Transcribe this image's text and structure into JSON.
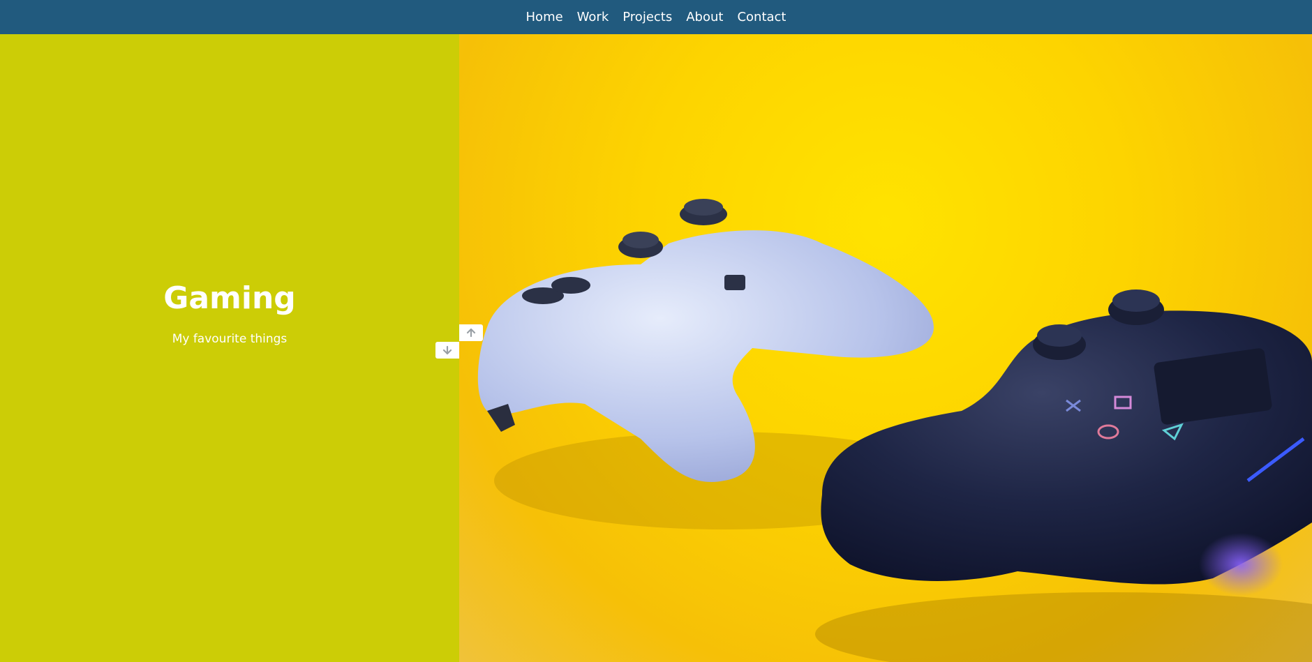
{
  "nav": {
    "items": [
      {
        "label": "Home"
      },
      {
        "label": "Work"
      },
      {
        "label": "Projects"
      },
      {
        "label": "About"
      },
      {
        "label": "Contact"
      }
    ]
  },
  "hero": {
    "title": "Gaming",
    "subtitle": "My favourite things"
  },
  "photo": {
    "subject": "two game controllers on yellow background"
  },
  "controls": {
    "up_icon": "arrow-up-icon",
    "down_icon": "arrow-down-icon"
  },
  "colors": {
    "nav_bg": "#215a7e",
    "panel_bg": "#cccd06",
    "photo_bg": "#fdd400",
    "white_controller": "#c9d3ef",
    "black_controller": "#1c2340"
  }
}
